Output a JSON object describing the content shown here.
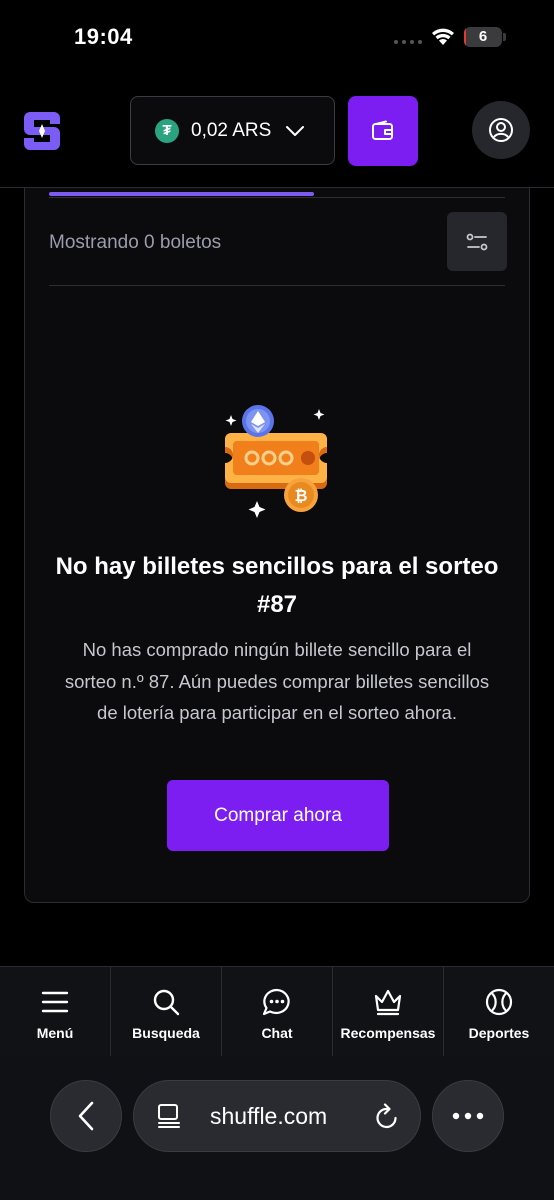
{
  "status_bar": {
    "time": "19:04",
    "battery_level": "6"
  },
  "header": {
    "balance": "0,02 ARS",
    "currency_icon": "tether-icon",
    "currency_symbol": "₮"
  },
  "tickets": {
    "showing_label": "Mostrando 0 boletos",
    "empty_title": "No hay billetes sencillos para el sorteo #87",
    "empty_description": "No has comprado ningún billete sencillo para el sorteo n.º 87. Aún puedes comprar billetes sencillos de lotería para participar en el sorteo ahora.",
    "buy_button_label": "Comprar ahora"
  },
  "bottom_nav": {
    "items": [
      {
        "label": "Menú",
        "icon": "menu-icon"
      },
      {
        "label": "Busqueda",
        "icon": "search-icon"
      },
      {
        "label": "Chat",
        "icon": "chat-icon"
      },
      {
        "label": "Recompensas",
        "icon": "crown-icon"
      },
      {
        "label": "Deportes",
        "icon": "tennis-ball-icon"
      }
    ]
  },
  "browser": {
    "url": "shuffle.com"
  },
  "colors": {
    "accent": "#7c1ef2",
    "tab_indicator": "#7c5cf0",
    "tether": "#2aa381"
  }
}
